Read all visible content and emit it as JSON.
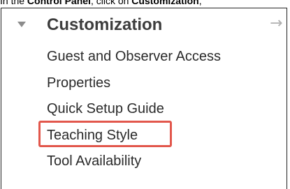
{
  "caption": {
    "prefix": "In the ",
    "control_panel": "Control Panel",
    "middle": ", click on ",
    "customization": "Customization",
    "suffix": ","
  },
  "section": {
    "title": "Customization",
    "expand_icon": "triangle-down-icon",
    "collapse_icon": "arrow-right-icon",
    "collapse_glyph": "→"
  },
  "menu": {
    "items": [
      {
        "label": "Guest and Observer Access"
      },
      {
        "label": "Properties"
      },
      {
        "label": "Quick Setup Guide"
      },
      {
        "label": "Teaching Style",
        "highlighted": true
      },
      {
        "label": "Tool Availability"
      }
    ]
  },
  "colors": {
    "highlight": "#e2574c",
    "text": "#2a2a2a",
    "title": "#3d3d3d",
    "icon": "#8c8c8c"
  }
}
